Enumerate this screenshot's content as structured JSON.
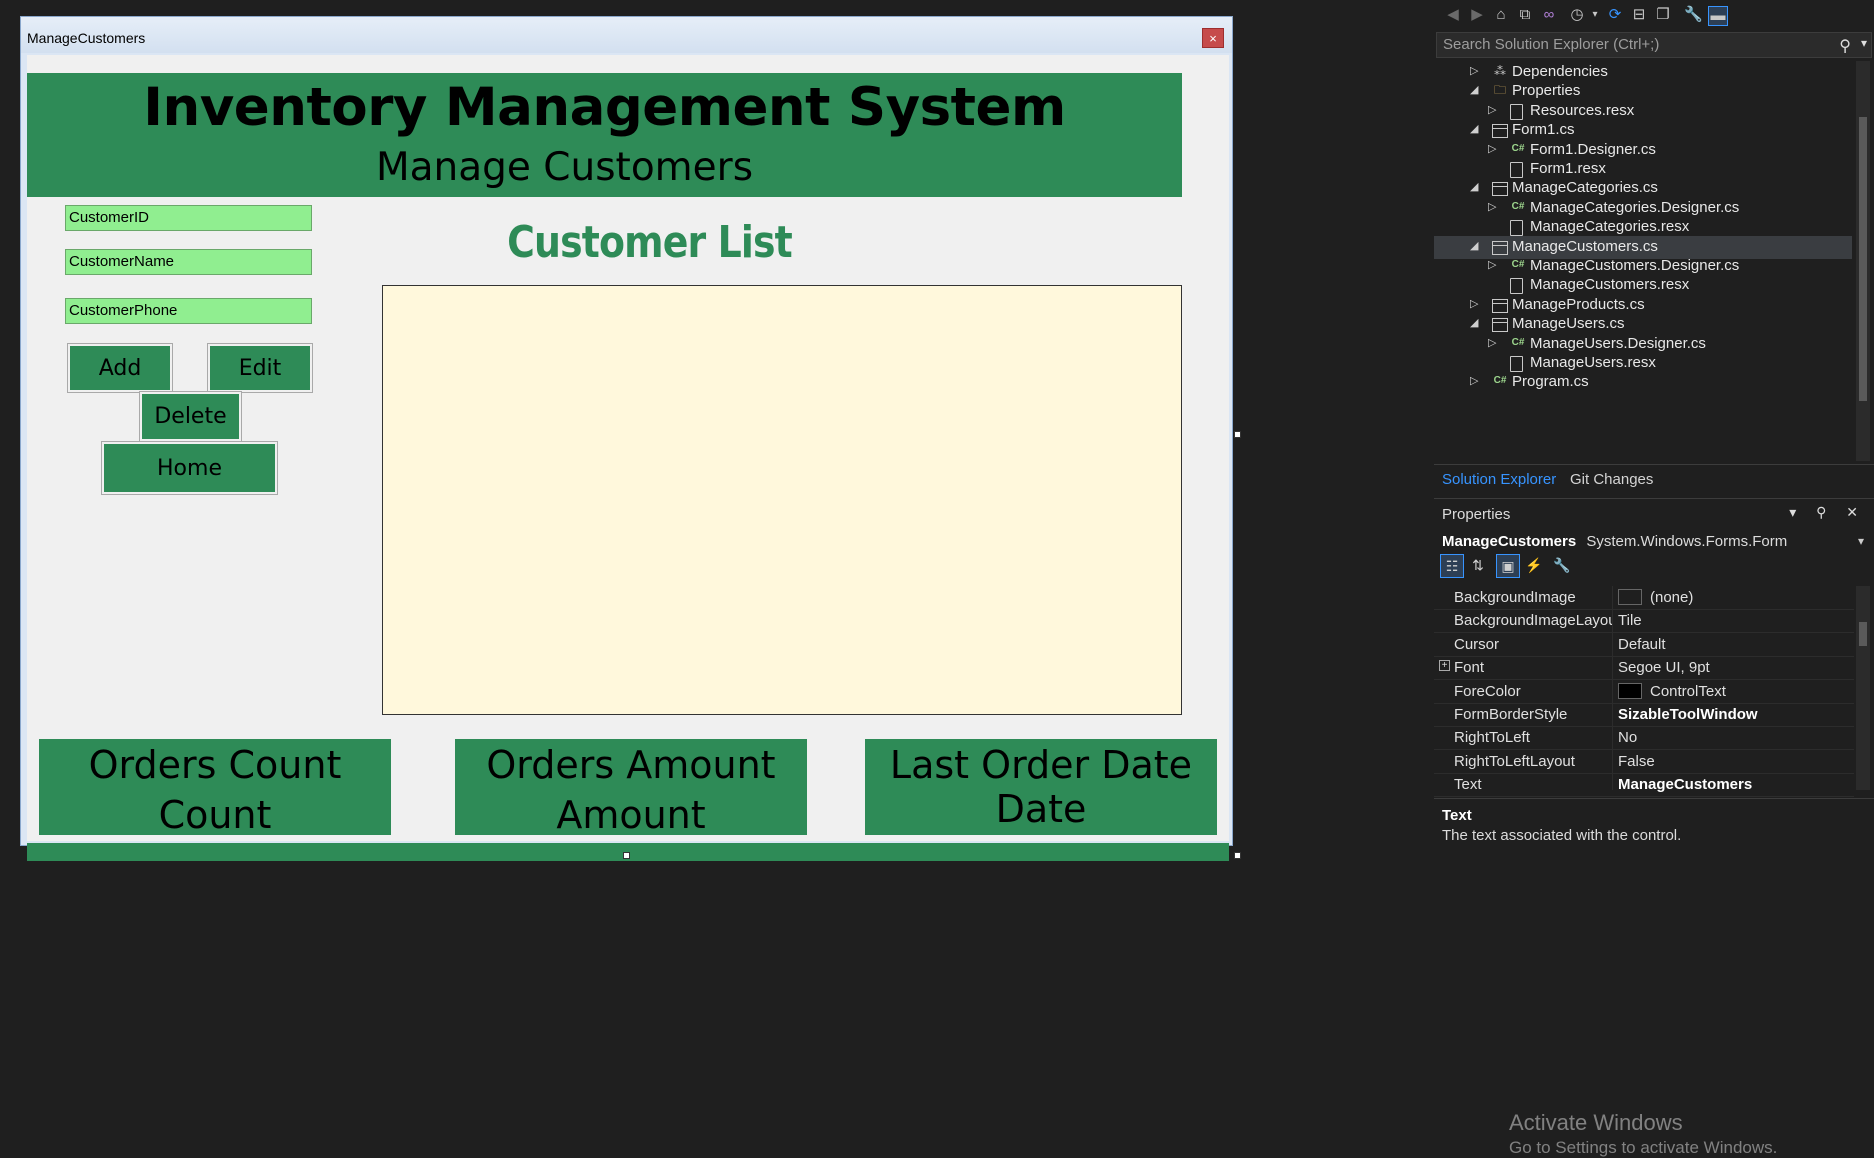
{
  "designer": {
    "form": {
      "title": "ManageCustomers",
      "close_glyph": "×",
      "app_title": "Inventory Management System",
      "subtitle": "Manage Customers",
      "fields": [
        {
          "placeholder": "CustomerID"
        },
        {
          "placeholder": "CustomerName"
        },
        {
          "placeholder": "CustomerPhone"
        }
      ],
      "buttons": {
        "add": "Add",
        "edit": "Edit",
        "delete": "Delete",
        "home": "Home"
      },
      "list_title": "Customer List",
      "stats": [
        {
          "line1": "Orders Count",
          "line2": "Count"
        },
        {
          "line1": "Orders Amount",
          "line2": "Amount"
        },
        {
          "line1": "Last Order Date",
          "line2": "Date"
        }
      ]
    },
    "colors": {
      "panel": "#2e8b57",
      "field": "#90ee90",
      "grid": "#fff8dc",
      "list_title": "#2e8b57"
    }
  },
  "solution_explorer": {
    "search_placeholder": "Search Solution Explorer (Ctrl+;)",
    "tree": [
      {
        "label": "Dependencies",
        "icon": "dependencies-icon",
        "expand": "collapsed",
        "indent": 1
      },
      {
        "label": "Properties",
        "icon": "folder-icon",
        "expand": "expanded",
        "indent": 1
      },
      {
        "label": "Resources.resx",
        "icon": "file-icon",
        "expand": "collapsed",
        "indent": 2
      },
      {
        "label": "Form1.cs",
        "icon": "form-icon",
        "expand": "expanded",
        "indent": 1
      },
      {
        "label": "Form1.Designer.cs",
        "icon": "csharp-icon",
        "expand": "collapsed",
        "indent": 2
      },
      {
        "label": "Form1.resx",
        "icon": "file-icon",
        "expand": "none",
        "indent": 2
      },
      {
        "label": "ManageCategories.cs",
        "icon": "form-icon",
        "expand": "expanded",
        "indent": 1
      },
      {
        "label": "ManageCategories.Designer.cs",
        "icon": "csharp-icon",
        "expand": "collapsed",
        "indent": 2
      },
      {
        "label": "ManageCategories.resx",
        "icon": "file-icon",
        "expand": "none",
        "indent": 2
      },
      {
        "label": "ManageCustomers.cs",
        "icon": "form-icon",
        "expand": "expanded",
        "indent": 1,
        "selected": true
      },
      {
        "label": "ManageCustomers.Designer.cs",
        "icon": "csharp-icon",
        "expand": "collapsed",
        "indent": 2
      },
      {
        "label": "ManageCustomers.resx",
        "icon": "file-icon",
        "expand": "none",
        "indent": 2
      },
      {
        "label": "ManageProducts.cs",
        "icon": "form-icon",
        "expand": "collapsed",
        "indent": 1
      },
      {
        "label": "ManageUsers.cs",
        "icon": "form-icon",
        "expand": "expanded",
        "indent": 1
      },
      {
        "label": "ManageUsers.Designer.cs",
        "icon": "csharp-icon",
        "expand": "collapsed",
        "indent": 2
      },
      {
        "label": "ManageUsers.resx",
        "icon": "file-icon",
        "expand": "none",
        "indent": 2
      },
      {
        "label": "Program.cs",
        "icon": "csharp-icon",
        "expand": "collapsed",
        "indent": 1
      }
    ],
    "tabs": {
      "solution_explorer": "Solution Explorer",
      "git_changes": "Git Changes"
    }
  },
  "properties": {
    "title": "Properties",
    "object_name": "ManageCustomers",
    "object_type": "System.Windows.Forms.Form",
    "rows": [
      {
        "name": "BackgroundImage",
        "value": "(none)",
        "swatch": "#1f1f1f"
      },
      {
        "name": "BackgroundImageLayout",
        "value": "Tile"
      },
      {
        "name": "Cursor",
        "value": "Default"
      },
      {
        "name": "Font",
        "value": "Segoe UI, 9pt",
        "expandable": true
      },
      {
        "name": "ForeColor",
        "value": "ControlText",
        "swatch": "#000000"
      },
      {
        "name": "FormBorderStyle",
        "value": "SizableToolWindow",
        "bold": true
      },
      {
        "name": "RightToLeft",
        "value": "No"
      },
      {
        "name": "RightToLeftLayout",
        "value": "False"
      },
      {
        "name": "Text",
        "value": "ManageCustomers",
        "bold": true
      }
    ],
    "description_title": "Text",
    "description_text": "The text associated with the control.",
    "watermark_line1": "Activate Windows",
    "watermark_line2": "Go to Settings to activate Windows."
  }
}
